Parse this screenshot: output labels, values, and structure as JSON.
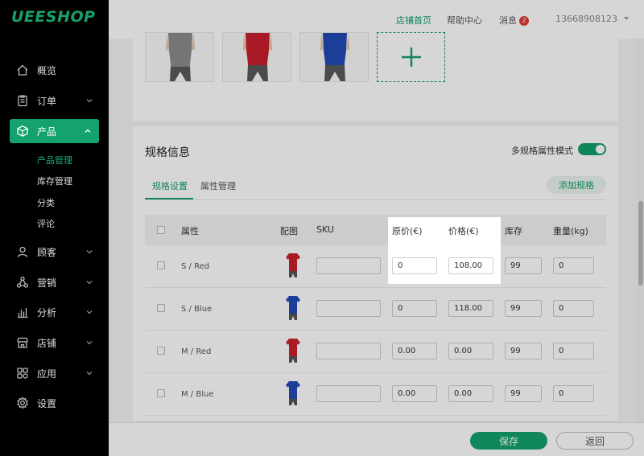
{
  "logo": "UEESHOP",
  "sidebar": {
    "items": [
      {
        "label": "概览",
        "icon": "home-icon"
      },
      {
        "label": "订单",
        "icon": "clipboard-icon"
      },
      {
        "label": "产品",
        "icon": "box-icon"
      },
      {
        "label": "顾客",
        "icon": "user-icon"
      },
      {
        "label": "营销",
        "icon": "share-icon"
      },
      {
        "label": "分析",
        "icon": "chart-icon"
      },
      {
        "label": "店铺",
        "icon": "store-icon"
      },
      {
        "label": "应用",
        "icon": "apps-icon"
      },
      {
        "label": "设置",
        "icon": "gear-icon"
      }
    ],
    "sub_items": [
      "产品管理",
      "库存管理",
      "分类",
      "评论"
    ]
  },
  "topbar": {
    "store_home": "店铺首页",
    "help": "帮助中心",
    "messages": "消息",
    "message_count": "2",
    "account": "13668908123"
  },
  "spec": {
    "title": "规格信息",
    "mode_label": "多规格属性模式",
    "tabs": [
      "规格设置",
      "属性管理"
    ],
    "add_button": "添加规格",
    "columns": [
      "属性",
      "配图",
      "SKU",
      "原价(€)",
      "价格(€)",
      "库存",
      "重量(kg)"
    ],
    "rows": [
      {
        "attr": "S / Red",
        "color": "red",
        "sku": "",
        "original": "0",
        "price": "108.00",
        "stock": "99",
        "weight": "0"
      },
      {
        "attr": "S / Blue",
        "color": "blue",
        "sku": "",
        "original": "0",
        "price": "118.00",
        "stock": "99",
        "weight": "0"
      },
      {
        "attr": "M / Red",
        "color": "red",
        "sku": "",
        "original": "0.00",
        "price": "0.00",
        "stock": "99",
        "weight": "0"
      },
      {
        "attr": "M / Blue",
        "color": "blue",
        "sku": "",
        "original": "0.00",
        "price": "0.00",
        "stock": "99",
        "weight": "0"
      }
    ]
  },
  "bottom": {
    "save": "保存",
    "back": "返回"
  },
  "colors": {
    "brand": "#14a36e",
    "badge": "#e03a3a"
  }
}
